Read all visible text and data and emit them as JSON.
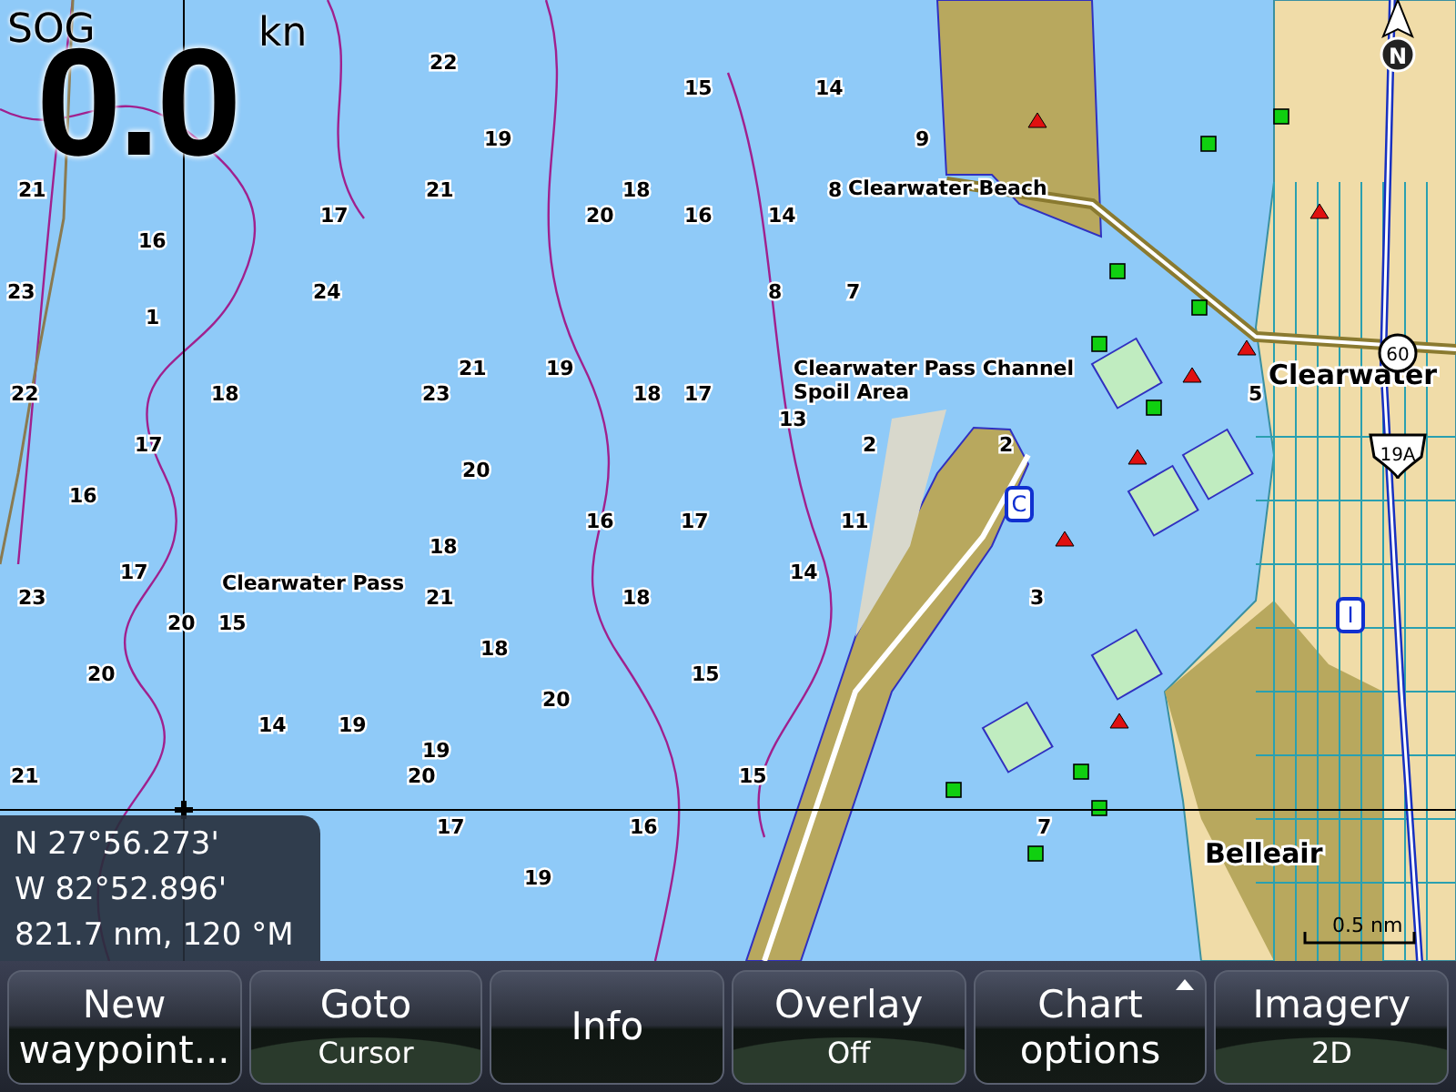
{
  "speed": {
    "label": "SOG",
    "value": "0.0",
    "unit": "kn"
  },
  "chart": {
    "compass": "N",
    "place_labels": [
      {
        "text": "Clearwater Beach",
        "kind": "place"
      },
      {
        "text": "Clearwater Pass Channel",
        "kind": "place"
      },
      {
        "text": "Spoil Area",
        "kind": "place"
      },
      {
        "text": "Clearwater Pass",
        "kind": "place"
      },
      {
        "text": "Clearwater",
        "kind": "town"
      },
      {
        "text": "Belleair",
        "kind": "town"
      }
    ],
    "route_shields": [
      {
        "text": "60",
        "kind": "circle"
      },
      {
        "text": "19A",
        "kind": "shield"
      },
      {
        "text": "C",
        "kind": "box"
      },
      {
        "text": "I",
        "kind": "box"
      }
    ],
    "soundings": [
      "22",
      "15",
      "14",
      "19",
      "9",
      "21",
      "21",
      "18",
      "8",
      "17",
      "20",
      "16",
      "14",
      "16",
      "23",
      "24",
      "8",
      "7",
      "1",
      "21",
      "19",
      "22",
      "18",
      "23",
      "18",
      "17",
      "5",
      "13",
      "17",
      "2",
      "2",
      "20",
      "16",
      "16",
      "17",
      "11",
      "18",
      "17",
      "14",
      "23",
      "21",
      "18",
      "3",
      "20",
      "15",
      "18",
      "20",
      "15",
      "20",
      "14",
      "19",
      "19",
      "21",
      "20",
      "15",
      "17",
      "16",
      "7",
      "19"
    ],
    "scale": "0.5 nm"
  },
  "cursor_info": [
    "N  27°56.273'",
    "W  82°52.896'",
    "821.7 nm, 120 °M"
  ],
  "buttons": [
    {
      "label": "New waypoint...",
      "popup": false
    },
    {
      "label": "Goto",
      "sub": "Cursor",
      "popup": false
    },
    {
      "label": "Info",
      "popup": false
    },
    {
      "label": "Overlay",
      "sub": "Off",
      "popup": false
    },
    {
      "label": "Chart options",
      "popup": true
    },
    {
      "label": "Imagery",
      "sub": "2D",
      "popup": false
    }
  ]
}
